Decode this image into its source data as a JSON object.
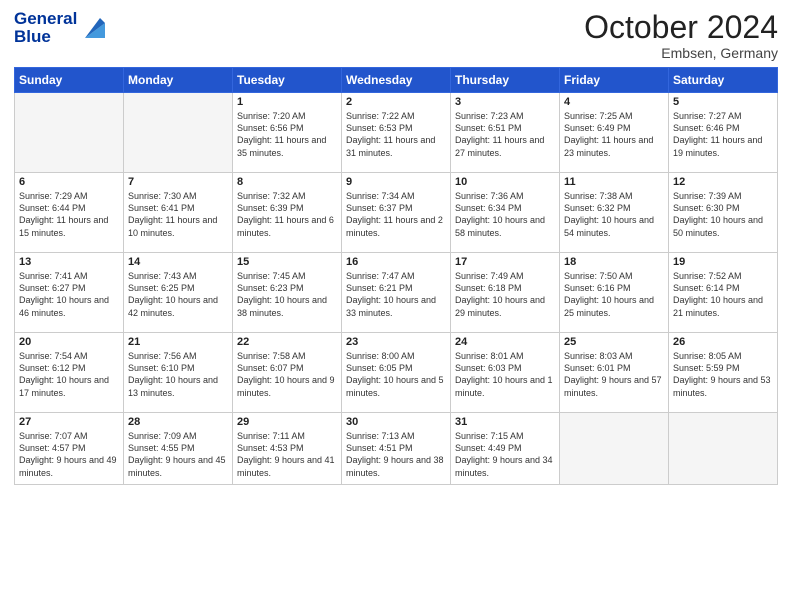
{
  "header": {
    "logo_line1": "General",
    "logo_line2": "Blue",
    "month": "October 2024",
    "location": "Embsen, Germany"
  },
  "weekdays": [
    "Sunday",
    "Monday",
    "Tuesday",
    "Wednesday",
    "Thursday",
    "Friday",
    "Saturday"
  ],
  "weeks": [
    [
      {
        "day": "",
        "sunrise": "",
        "sunset": "",
        "daylight": ""
      },
      {
        "day": "",
        "sunrise": "",
        "sunset": "",
        "daylight": ""
      },
      {
        "day": "1",
        "sunrise": "Sunrise: 7:20 AM",
        "sunset": "Sunset: 6:56 PM",
        "daylight": "Daylight: 11 hours and 35 minutes."
      },
      {
        "day": "2",
        "sunrise": "Sunrise: 7:22 AM",
        "sunset": "Sunset: 6:53 PM",
        "daylight": "Daylight: 11 hours and 31 minutes."
      },
      {
        "day": "3",
        "sunrise": "Sunrise: 7:23 AM",
        "sunset": "Sunset: 6:51 PM",
        "daylight": "Daylight: 11 hours and 27 minutes."
      },
      {
        "day": "4",
        "sunrise": "Sunrise: 7:25 AM",
        "sunset": "Sunset: 6:49 PM",
        "daylight": "Daylight: 11 hours and 23 minutes."
      },
      {
        "day": "5",
        "sunrise": "Sunrise: 7:27 AM",
        "sunset": "Sunset: 6:46 PM",
        "daylight": "Daylight: 11 hours and 19 minutes."
      }
    ],
    [
      {
        "day": "6",
        "sunrise": "Sunrise: 7:29 AM",
        "sunset": "Sunset: 6:44 PM",
        "daylight": "Daylight: 11 hours and 15 minutes."
      },
      {
        "day": "7",
        "sunrise": "Sunrise: 7:30 AM",
        "sunset": "Sunset: 6:41 PM",
        "daylight": "Daylight: 11 hours and 10 minutes."
      },
      {
        "day": "8",
        "sunrise": "Sunrise: 7:32 AM",
        "sunset": "Sunset: 6:39 PM",
        "daylight": "Daylight: 11 hours and 6 minutes."
      },
      {
        "day": "9",
        "sunrise": "Sunrise: 7:34 AM",
        "sunset": "Sunset: 6:37 PM",
        "daylight": "Daylight: 11 hours and 2 minutes."
      },
      {
        "day": "10",
        "sunrise": "Sunrise: 7:36 AM",
        "sunset": "Sunset: 6:34 PM",
        "daylight": "Daylight: 10 hours and 58 minutes."
      },
      {
        "day": "11",
        "sunrise": "Sunrise: 7:38 AM",
        "sunset": "Sunset: 6:32 PM",
        "daylight": "Daylight: 10 hours and 54 minutes."
      },
      {
        "day": "12",
        "sunrise": "Sunrise: 7:39 AM",
        "sunset": "Sunset: 6:30 PM",
        "daylight": "Daylight: 10 hours and 50 minutes."
      }
    ],
    [
      {
        "day": "13",
        "sunrise": "Sunrise: 7:41 AM",
        "sunset": "Sunset: 6:27 PM",
        "daylight": "Daylight: 10 hours and 46 minutes."
      },
      {
        "day": "14",
        "sunrise": "Sunrise: 7:43 AM",
        "sunset": "Sunset: 6:25 PM",
        "daylight": "Daylight: 10 hours and 42 minutes."
      },
      {
        "day": "15",
        "sunrise": "Sunrise: 7:45 AM",
        "sunset": "Sunset: 6:23 PM",
        "daylight": "Daylight: 10 hours and 38 minutes."
      },
      {
        "day": "16",
        "sunrise": "Sunrise: 7:47 AM",
        "sunset": "Sunset: 6:21 PM",
        "daylight": "Daylight: 10 hours and 33 minutes."
      },
      {
        "day": "17",
        "sunrise": "Sunrise: 7:49 AM",
        "sunset": "Sunset: 6:18 PM",
        "daylight": "Daylight: 10 hours and 29 minutes."
      },
      {
        "day": "18",
        "sunrise": "Sunrise: 7:50 AM",
        "sunset": "Sunset: 6:16 PM",
        "daylight": "Daylight: 10 hours and 25 minutes."
      },
      {
        "day": "19",
        "sunrise": "Sunrise: 7:52 AM",
        "sunset": "Sunset: 6:14 PM",
        "daylight": "Daylight: 10 hours and 21 minutes."
      }
    ],
    [
      {
        "day": "20",
        "sunrise": "Sunrise: 7:54 AM",
        "sunset": "Sunset: 6:12 PM",
        "daylight": "Daylight: 10 hours and 17 minutes."
      },
      {
        "day": "21",
        "sunrise": "Sunrise: 7:56 AM",
        "sunset": "Sunset: 6:10 PM",
        "daylight": "Daylight: 10 hours and 13 minutes."
      },
      {
        "day": "22",
        "sunrise": "Sunrise: 7:58 AM",
        "sunset": "Sunset: 6:07 PM",
        "daylight": "Daylight: 10 hours and 9 minutes."
      },
      {
        "day": "23",
        "sunrise": "Sunrise: 8:00 AM",
        "sunset": "Sunset: 6:05 PM",
        "daylight": "Daylight: 10 hours and 5 minutes."
      },
      {
        "day": "24",
        "sunrise": "Sunrise: 8:01 AM",
        "sunset": "Sunset: 6:03 PM",
        "daylight": "Daylight: 10 hours and 1 minute."
      },
      {
        "day": "25",
        "sunrise": "Sunrise: 8:03 AM",
        "sunset": "Sunset: 6:01 PM",
        "daylight": "Daylight: 9 hours and 57 minutes."
      },
      {
        "day": "26",
        "sunrise": "Sunrise: 8:05 AM",
        "sunset": "Sunset: 5:59 PM",
        "daylight": "Daylight: 9 hours and 53 minutes."
      }
    ],
    [
      {
        "day": "27",
        "sunrise": "Sunrise: 7:07 AM",
        "sunset": "Sunset: 4:57 PM",
        "daylight": "Daylight: 9 hours and 49 minutes."
      },
      {
        "day": "28",
        "sunrise": "Sunrise: 7:09 AM",
        "sunset": "Sunset: 4:55 PM",
        "daylight": "Daylight: 9 hours and 45 minutes."
      },
      {
        "day": "29",
        "sunrise": "Sunrise: 7:11 AM",
        "sunset": "Sunset: 4:53 PM",
        "daylight": "Daylight: 9 hours and 41 minutes."
      },
      {
        "day": "30",
        "sunrise": "Sunrise: 7:13 AM",
        "sunset": "Sunset: 4:51 PM",
        "daylight": "Daylight: 9 hours and 38 minutes."
      },
      {
        "day": "31",
        "sunrise": "Sunrise: 7:15 AM",
        "sunset": "Sunset: 4:49 PM",
        "daylight": "Daylight: 9 hours and 34 minutes."
      },
      {
        "day": "",
        "sunrise": "",
        "sunset": "",
        "daylight": ""
      },
      {
        "day": "",
        "sunrise": "",
        "sunset": "",
        "daylight": ""
      }
    ]
  ]
}
